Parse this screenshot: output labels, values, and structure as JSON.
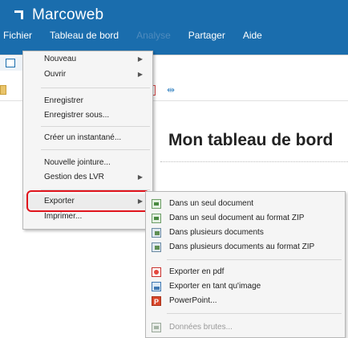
{
  "app": {
    "title": "Marcoweb"
  },
  "menubar": {
    "items": [
      {
        "label": "Fichier"
      },
      {
        "label": "Tableau de bord"
      },
      {
        "label": "Analyse",
        "disabled": true
      },
      {
        "label": "Partager"
      },
      {
        "label": "Aide"
      }
    ]
  },
  "report": {
    "title": "Mon tableau de bord"
  },
  "file_menu": {
    "items": [
      {
        "label": "Nouveau",
        "has_submenu": true
      },
      {
        "label": "Ouvrir",
        "has_submenu": true
      },
      {
        "label": "Enregistrer",
        "has_submenu": false
      },
      {
        "label": "Enregistrer sous...",
        "has_submenu": false
      },
      {
        "label": "Créer un instantané...",
        "has_submenu": false
      },
      {
        "label": "Nouvelle jointure...",
        "has_submenu": false
      },
      {
        "label": "Gestion des LVR",
        "has_submenu": true
      },
      {
        "label": "Exporter",
        "has_submenu": true,
        "highlighted": true
      },
      {
        "label": "Imprimer...",
        "has_submenu": false
      }
    ]
  },
  "export_submenu": {
    "items": [
      {
        "label": "Dans un seul document",
        "icon": "document-export-icon"
      },
      {
        "label": "Dans un seul document au format ZIP",
        "icon": "zip-document-icon"
      },
      {
        "label": "Dans plusieurs documents",
        "icon": "multi-documents-icon"
      },
      {
        "label": "Dans plusieurs documents au format ZIP",
        "icon": "multi-zip-documents-icon"
      },
      {
        "label": "Exporter en pdf",
        "icon": "pdf-icon"
      },
      {
        "label": "Exporter en tant qu'image",
        "icon": "image-icon"
      },
      {
        "label": "PowerPoint...",
        "icon": "powerpoint-icon"
      },
      {
        "label": "Données brutes...",
        "icon": "raw-data-icon",
        "disabled": true
      }
    ]
  },
  "colors": {
    "header": "#1a6dad",
    "highlight_box": "#e0141c"
  }
}
